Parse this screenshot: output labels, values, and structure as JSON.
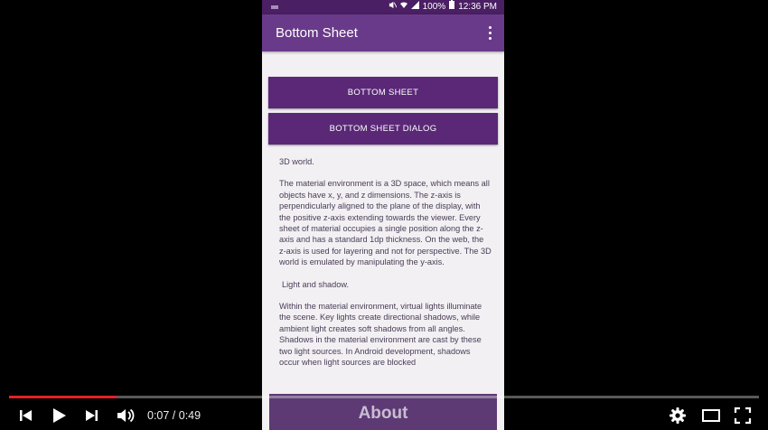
{
  "status_bar": {
    "battery": "100%",
    "time": "12:36 PM"
  },
  "app_bar": {
    "title": "Bottom Sheet"
  },
  "buttons": {
    "bottom_sheet": "BOTTOM SHEET",
    "bottom_sheet_dialog": "BOTTOM SHEET DIALOG"
  },
  "content": {
    "p1": "3D world.",
    "p2": "The material environment is a 3D space, which means all objects have x, y, and z  dimensions. The z-axis is perpendicularly aligned to the plane of the display, with the  positive z-axis extending towards the viewer. Every sheet of material occupies a single  position along the z-axis and has a standard 1dp thickness. On the web, the z-axis is used for layering and not for perspective. The 3D world is  emulated by manipulating the y-axis.",
    "p3": "Light and shadow.",
    "p4": "Within the material environment, virtual lights illuminate the scene. Key lights create  directional shadows, while ambient light creates soft shadows from all angles.",
    "p5": "Shadows in the material environment are cast by these two light sources. In Android  development, shadows occur when light sources are blocked"
  },
  "bottom_bar": {
    "label": "About"
  },
  "player": {
    "time_display": "0:07 / 0:49",
    "progress_fraction": 0.143,
    "accent": "#e52127"
  },
  "colors": {
    "primary": "#6a3a8a",
    "primary_dark": "#4a1f63",
    "button": "#5a2877"
  }
}
